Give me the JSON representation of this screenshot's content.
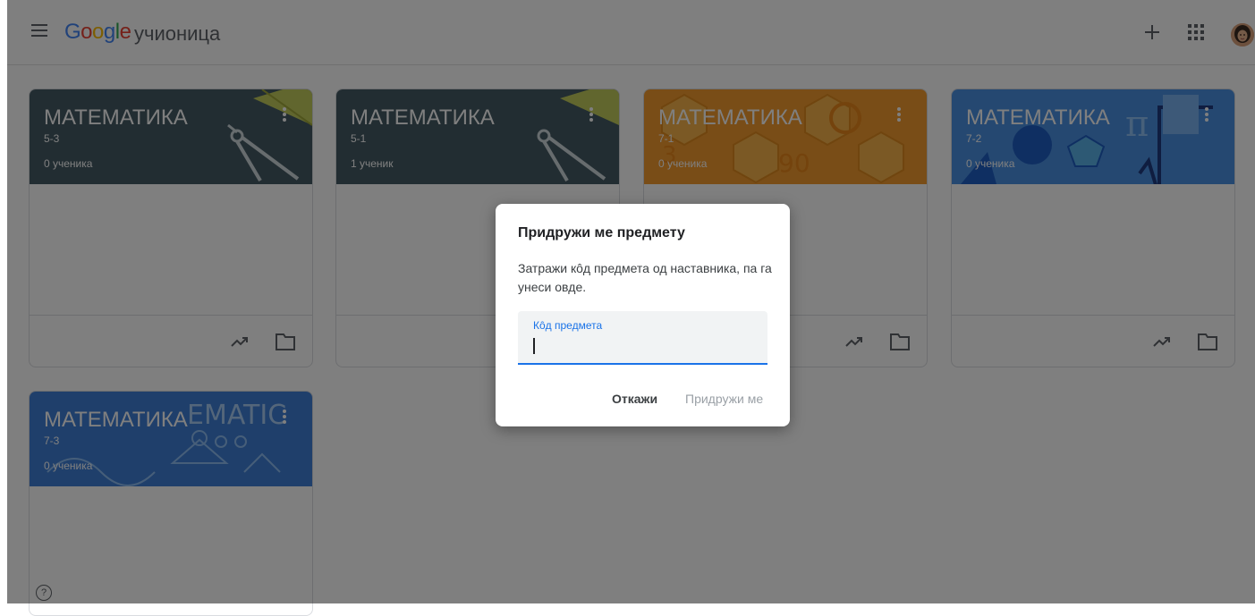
{
  "header": {
    "logo": {
      "G": "G",
      "o1": "o",
      "o2": "o",
      "g": "g",
      "l": "l",
      "e": "e"
    },
    "product": "учионица",
    "icons": {
      "menu": "menu-icon",
      "add": "plus-icon",
      "apps": "apps-grid-icon",
      "account": "avatar"
    }
  },
  "colors": {
    "google_blue": "#4285f4",
    "google_red": "#ea4335",
    "google_yellow": "#fbbc05",
    "google_green": "#34a853",
    "accent": "#1a73e8",
    "scrim": "#000000"
  },
  "classes": [
    {
      "title": "МАТЕМАТИКА",
      "section": "5-3",
      "students": "0 ученика",
      "theme": "dark-compass"
    },
    {
      "title": "МАТЕМАТИКА",
      "section": "5-1",
      "students": "1 ученик",
      "theme": "dark-compass"
    },
    {
      "title": "МАТЕМАТИКА",
      "section": "7-1",
      "students": "0 ученика",
      "theme": "orange-hexagons"
    },
    {
      "title": "МАТЕМАТИКА",
      "section": "7-2",
      "students": "0 ученика",
      "theme": "blue-shapes"
    },
    {
      "title": "МАТЕМАТИКА",
      "section": "7-3",
      "students": "0 ученика",
      "theme": "blue-doodles"
    }
  ],
  "dialog": {
    "title": "Придружи ме предмету",
    "description": "Затражи кôд предмета од наставника, па га унеси овде.",
    "field_label": "Кôд предмета",
    "field_value": "",
    "cancel_label": "Откажи",
    "join_label": "Придружи ме"
  },
  "help": {
    "label": "?"
  }
}
